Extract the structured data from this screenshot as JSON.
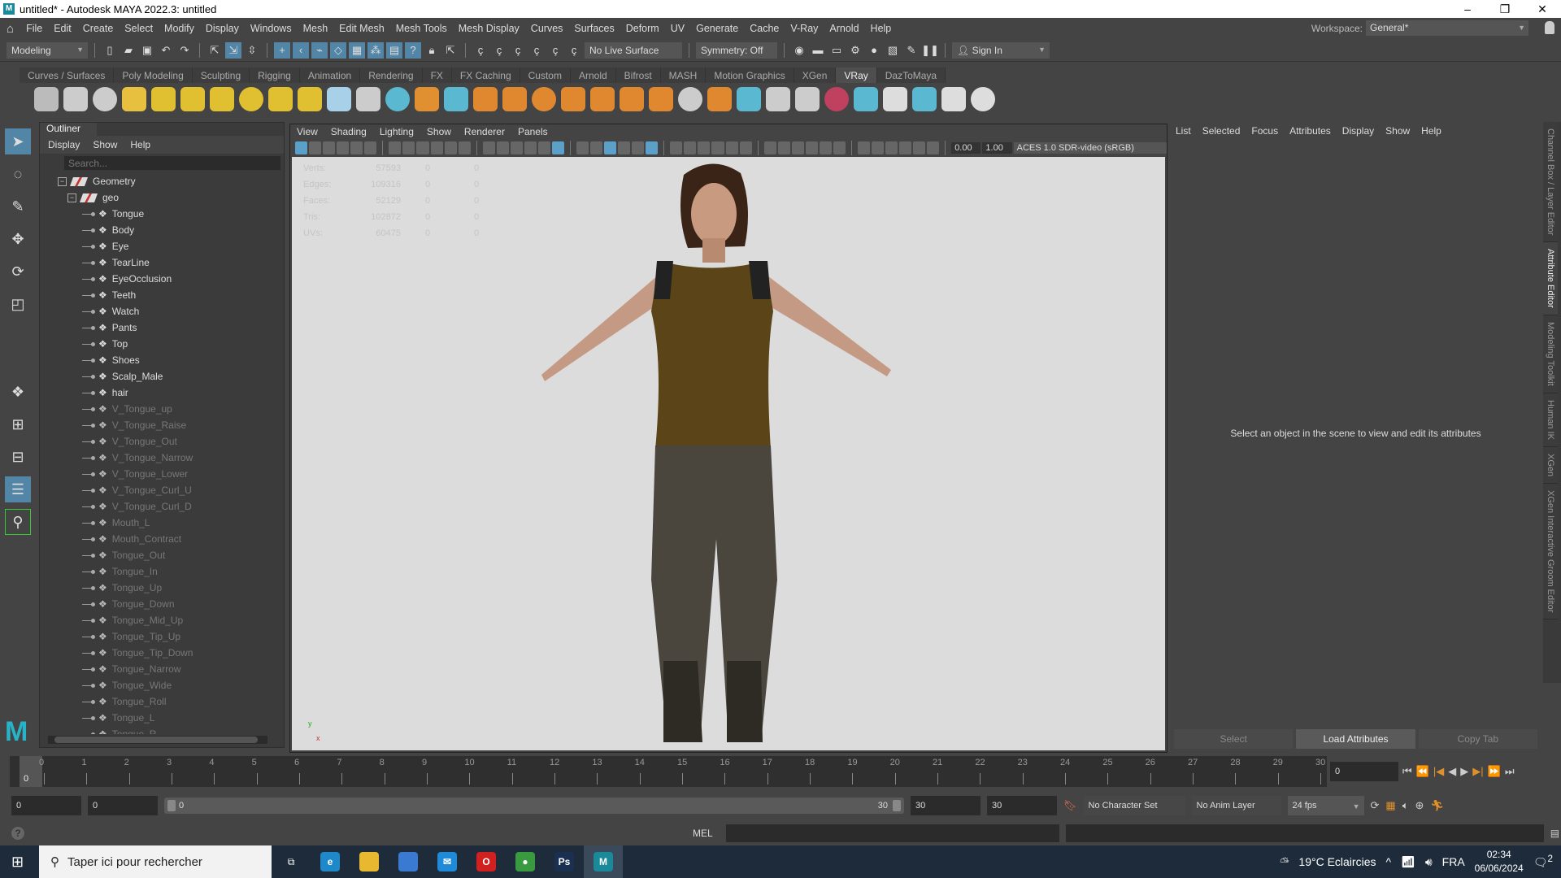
{
  "window": {
    "title": "untitled* - Autodesk MAYA 2022.3: untitled",
    "logo": "M",
    "controls": [
      "–",
      "❐",
      "✕"
    ]
  },
  "menubar": {
    "items": [
      "File",
      "Edit",
      "Create",
      "Select",
      "Modify",
      "Display",
      "Windows",
      "Mesh",
      "Edit Mesh",
      "Mesh Tools",
      "Mesh Display",
      "Curves",
      "Surfaces",
      "Deform",
      "UV",
      "Generate",
      "Cache",
      "V-Ray",
      "Arnold",
      "Help"
    ],
    "workspace_label": "Workspace:",
    "workspace_value": "General*"
  },
  "statusline": {
    "mode": "Modeling",
    "live_surface": "No Live Surface",
    "symmetry": "Symmetry: Off",
    "sign_in": "Sign In"
  },
  "shelf": {
    "tabs": [
      "Curves / Surfaces",
      "Poly Modeling",
      "Sculpting",
      "Rigging",
      "Animation",
      "Rendering",
      "FX",
      "FX Caching",
      "Custom",
      "Arnold",
      "Bifrost",
      "MASH",
      "Motion Graphics",
      "XGen",
      "VRay",
      "DazToMaya"
    ],
    "active_tab": "VRay",
    "icon_colors": [
      "#bbbbbb",
      "#cccccc",
      "#cccccc",
      "#e8c040",
      "#e0c030",
      "#e0c030",
      "#e0c030",
      "#e0c030",
      "#e0c030",
      "#e0c030",
      "#a8d0e8",
      "#cccccc",
      "#5ab8d0",
      "#e09030",
      "#5ab8d0",
      "#e08830",
      "#e08830",
      "#e08830",
      "#e08830",
      "#e08830",
      "#e08830",
      "#e08830",
      "#cccccc",
      "#e08830",
      "#5ab8d0",
      "#cccccc",
      "#cccccc",
      "#c04060",
      "#5ab8d0",
      "#dddddd",
      "#5ab8d0",
      "#dddddd",
      "#dddddd"
    ]
  },
  "outliner": {
    "title": "Outliner",
    "menu": [
      "Display",
      "Show",
      "Help"
    ],
    "search_placeholder": "Search...",
    "groups": [
      "Geometry",
      "geo"
    ],
    "items": [
      {
        "name": "Tongue",
        "dim": false
      },
      {
        "name": "Body",
        "dim": false
      },
      {
        "name": "Eye",
        "dim": false
      },
      {
        "name": "TearLine",
        "dim": false
      },
      {
        "name": "EyeOcclusion",
        "dim": false
      },
      {
        "name": "Teeth",
        "dim": false
      },
      {
        "name": "Watch",
        "dim": false
      },
      {
        "name": "Pants",
        "dim": false
      },
      {
        "name": "Top",
        "dim": false
      },
      {
        "name": "Shoes",
        "dim": false
      },
      {
        "name": "Scalp_Male",
        "dim": false
      },
      {
        "name": "hair",
        "dim": false
      },
      {
        "name": "V_Tongue_up",
        "dim": true
      },
      {
        "name": "V_Tongue_Raise",
        "dim": true
      },
      {
        "name": "V_Tongue_Out",
        "dim": true
      },
      {
        "name": "V_Tongue_Narrow",
        "dim": true
      },
      {
        "name": "V_Tongue_Lower",
        "dim": true
      },
      {
        "name": "V_Tongue_Curl_U",
        "dim": true
      },
      {
        "name": "V_Tongue_Curl_D",
        "dim": true
      },
      {
        "name": "Mouth_L",
        "dim": true
      },
      {
        "name": "Mouth_Contract",
        "dim": true
      },
      {
        "name": "Tongue_Out",
        "dim": true
      },
      {
        "name": "Tongue_In",
        "dim": true
      },
      {
        "name": "Tongue_Up",
        "dim": true
      },
      {
        "name": "Tongue_Down",
        "dim": true
      },
      {
        "name": "Tongue_Mid_Up",
        "dim": true
      },
      {
        "name": "Tongue_Tip_Up",
        "dim": true
      },
      {
        "name": "Tongue_Tip_Down",
        "dim": true
      },
      {
        "name": "Tongue_Narrow",
        "dim": true
      },
      {
        "name": "Tongue_Wide",
        "dim": true
      },
      {
        "name": "Tongue_Roll",
        "dim": true
      },
      {
        "name": "Tongue_L",
        "dim": true
      },
      {
        "name": "Tongue_R",
        "dim": true
      }
    ]
  },
  "viewport": {
    "menu": [
      "View",
      "Shading",
      "Lighting",
      "Show",
      "Renderer",
      "Panels"
    ],
    "exposure": "0.00",
    "gamma": "1.00",
    "color_space": "ACES 1.0 SDR-video (sRGB)",
    "hud": [
      {
        "label": "Verts:",
        "value": "57593",
        "a": "0",
        "b": "0"
      },
      {
        "label": "Edges:",
        "value": "109316",
        "a": "0",
        "b": "0"
      },
      {
        "label": "Faces:",
        "value": "52129",
        "a": "0",
        "b": "0"
      },
      {
        "label": "Tris:",
        "value": "102872",
        "a": "0",
        "b": "0"
      },
      {
        "label": "UVs:",
        "value": "60475",
        "a": "0",
        "b": "0"
      }
    ],
    "axis_y": "y",
    "axis_x": "x"
  },
  "attribute_editor": {
    "menu": [
      "List",
      "Selected",
      "Focus",
      "Attributes",
      "Display",
      "Show",
      "Help"
    ],
    "message": "Select an object in the scene to view and edit its attributes",
    "buttons": [
      "Select",
      "Load Attributes",
      "Copy Tab"
    ]
  },
  "side_tabs": [
    "Channel Box / Layer Editor",
    "Attribute Editor",
    "Modeling Toolkit",
    "Human IK",
    "XGen",
    "XGen Interactive Groom Editor"
  ],
  "timeline": {
    "start": 0,
    "end": 30,
    "current": "0",
    "current_field": "0"
  },
  "range": {
    "start": "0",
    "anim_start": "0",
    "slider_start": "0",
    "slider_end": "30",
    "anim_end": "30",
    "end": "30",
    "character_set": "No Character Set",
    "anim_layer": "No Anim Layer",
    "fps": "24 fps"
  },
  "cmdline": {
    "label": "MEL",
    "help": "?"
  },
  "taskbar": {
    "search": "Taper ici pour rechercher",
    "weather": "19°C  Eclaircies",
    "lang": "FRA",
    "time": "02:34",
    "date": "06/06/2024",
    "notifications": "2",
    "apps": [
      {
        "name": "edge",
        "color": "#1e88c8",
        "label": "e"
      },
      {
        "name": "file-explorer",
        "color": "#e8b830",
        "label": ""
      },
      {
        "name": "store",
        "color": "#3a7ad0",
        "label": ""
      },
      {
        "name": "mail",
        "color": "#1e8ad8",
        "label": "✉"
      },
      {
        "name": "opera",
        "color": "#d02020",
        "label": "O"
      },
      {
        "name": "chrome",
        "color": "#3a9a40",
        "label": "●"
      },
      {
        "name": "photoshop",
        "color": "#1a3050",
        "label": "Ps"
      },
      {
        "name": "maya",
        "color": "#1a8a9a",
        "label": "M"
      }
    ]
  }
}
